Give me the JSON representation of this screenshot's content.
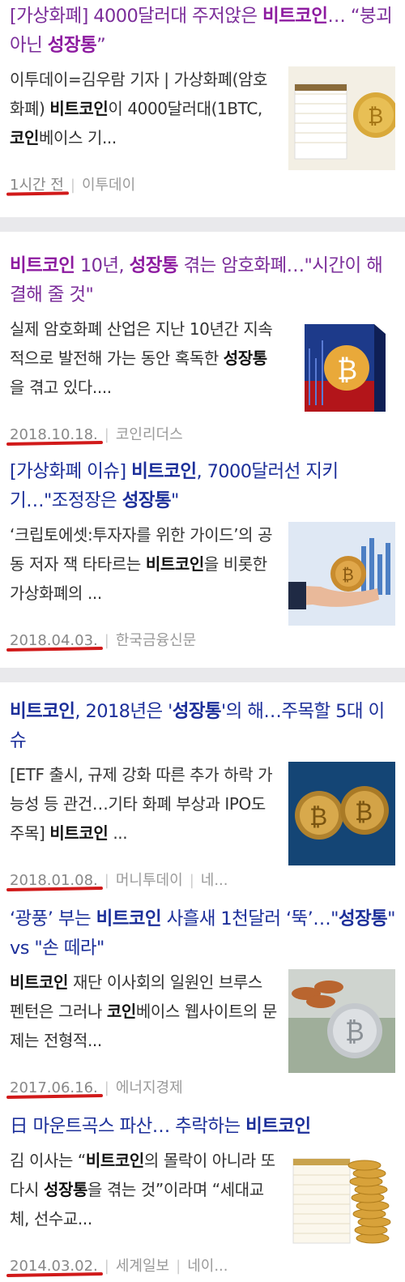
{
  "items": [
    {
      "title_html": "[가상화폐] 4000달러대 주저앉은 <b>비트코인</b>… “붕괴 아닌 <b>성장통</b>”",
      "snippet_html": "이투데이=김우람 기자 | 가상화폐(암호화폐) <b>비트코인</b>이 4000달러대(1BTC, <b>코인</b>베이스 기...",
      "date": "1시간 전",
      "source": "이투데이",
      "extra": "",
      "visited": true,
      "thumb_icon": "price-table-thumbnail"
    },
    {
      "title_html": "<b>비트코인</b> 10년, <b>성장통</b> 겪는 암호화폐…\"시간이 해결해 줄 것\"",
      "snippet_html": "실제 암호화폐 산업은 지난 10년간 지속적으로 발전해 가는 동안 혹독한 <b>성장통</b>을 겪고 있다....",
      "date": "2018.10.18.",
      "source": "코인리더스",
      "extra": "",
      "visited": true,
      "thumb_icon": "bitcoin-box-thumbnail"
    },
    {
      "title_html": "[가상화폐 이슈] <b>비트코인</b>, 7000달러선 지키기…\"조정장은 <b>성장통</b>\"",
      "snippet_html": "‘크립토에셋:투자자를 위한 가이드’의 공동 저자 잭 타타르는 <b>비트코인</b>을 비롯한 가상화폐의 ...",
      "date": "2018.04.03.",
      "source": "한국금융신문",
      "extra": "",
      "visited": false,
      "thumb_icon": "hand-coin-thumbnail"
    },
    {
      "title_html": "<b>비트코인</b>, 2018년은 '<b>성장통</b>'의 해…주목할 5대 이슈",
      "snippet_html": "[ETF 출시, 규제 강화 따른 추가 하락 가능성 등 관건…기타 화폐 부상과 IPO도 주목] <b>비트코인</b> ...",
      "date": "2018.01.08.",
      "source": "머니투데이",
      "extra": "네...",
      "visited": false,
      "thumb_icon": "coins-dollar-thumbnail"
    },
    {
      "title_html": "‘광풍’ 부는 <b>비트코인</b> 사흘새 1천달러 ‘뚝’…\"<b>성장통</b>\" vs \"손 떼라\"",
      "snippet_html": "<b>비트코인</b> 재단 이사회의 일원인 브루스 펜턴은 그러나 <b>코인</b>베이스 웹사이트의 문제는 전형적...",
      "date": "2017.06.16.",
      "source": "에너지경제",
      "extra": "",
      "visited": false,
      "thumb_icon": "silver-coin-thumbnail"
    },
    {
      "title_html": "日 마운트곡스 파산… 추락하는 <b>비트코인</b>",
      "snippet_html": "김 이사는 “<b>비트코인</b>의 몰락이 아니라 또다시 <b>성장통</b>을 겪는 것”이라며 “세대교체, 선수교...",
      "date": "2014.03.02.",
      "source": "세계일보",
      "extra": "네이...",
      "visited": false,
      "thumb_icon": "coin-stack-thumbnail"
    }
  ],
  "colors": {
    "title_unvisited": "#1c2f9a",
    "title_visited": "#7b2d9a",
    "underline": "#d11a1a"
  }
}
